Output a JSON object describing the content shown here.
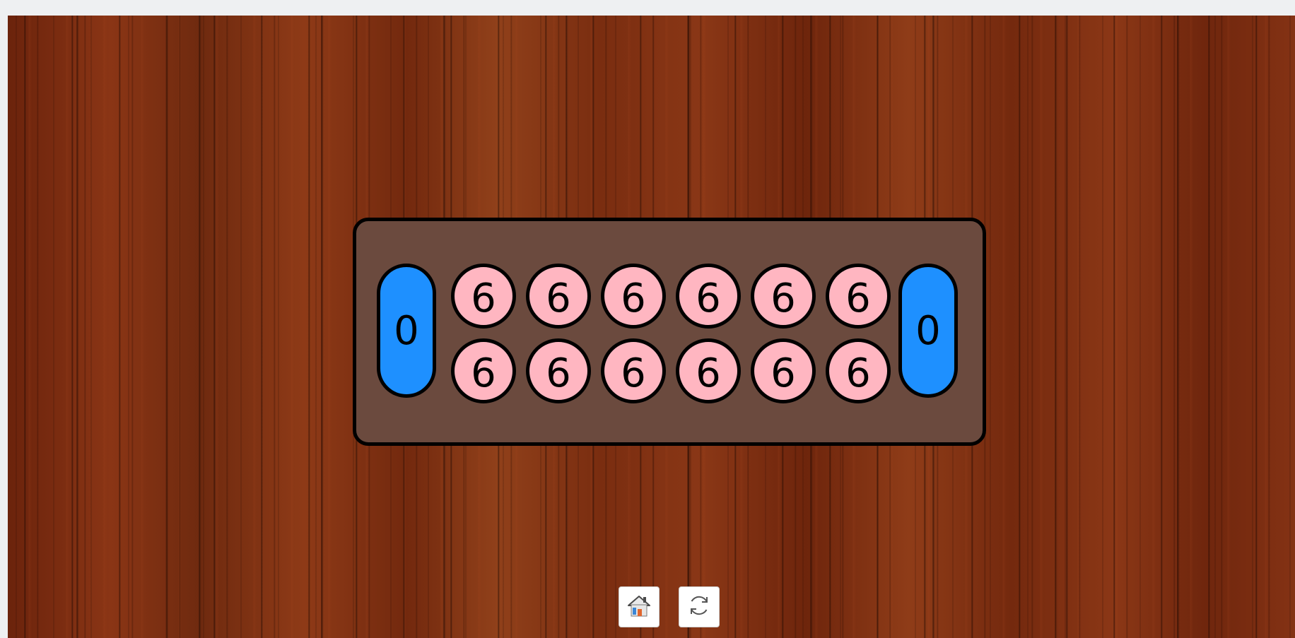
{
  "board": {
    "left_store": "0",
    "right_store": "0",
    "top_row": [
      "6",
      "6",
      "6",
      "6",
      "6",
      "6"
    ],
    "bottom_row": [
      "6",
      "6",
      "6",
      "6",
      "6",
      "6"
    ]
  },
  "controls": {
    "home_icon": "house-icon",
    "restart_icon": "refresh-icon"
  },
  "colors": {
    "board": "#6b4a3e",
    "store": "#1e90ff",
    "pit": "#ffb6c1",
    "outline": "#000000"
  }
}
